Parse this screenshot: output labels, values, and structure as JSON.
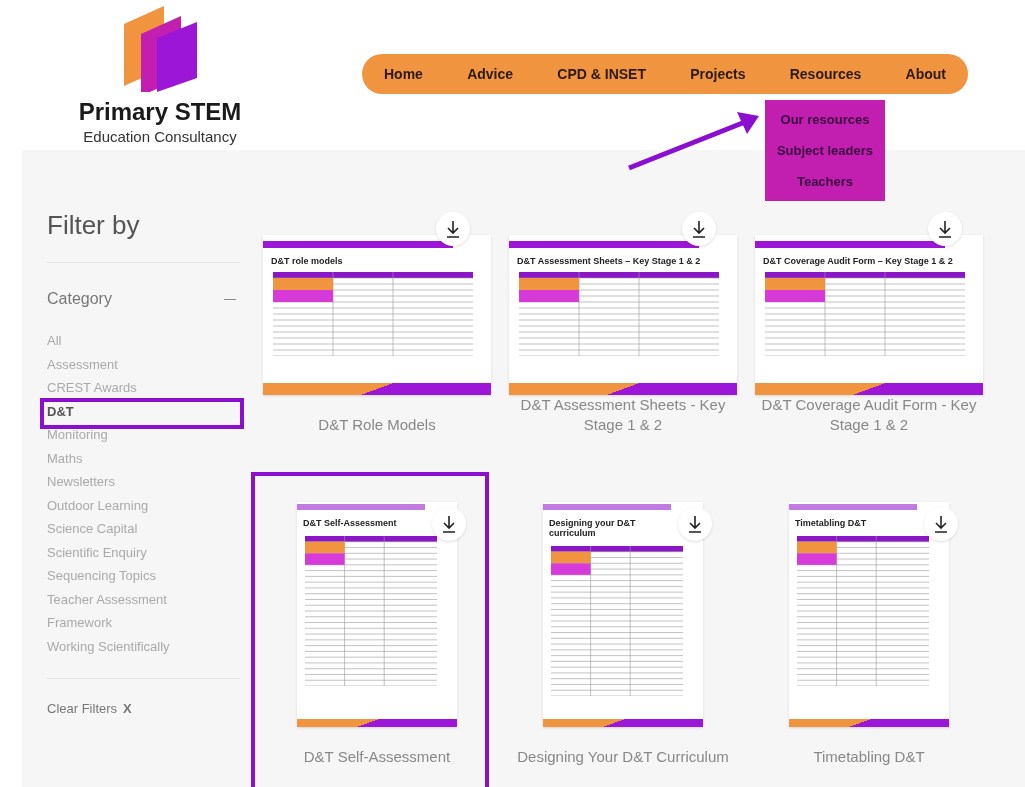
{
  "logo": {
    "title": "Primary STEM",
    "subtitle": "Education Consultancy"
  },
  "nav": [
    {
      "label": "Home"
    },
    {
      "label": "Advice"
    },
    {
      "label": "CPD & INSET"
    },
    {
      "label": "Projects"
    },
    {
      "label": "Resources",
      "expanded": true
    },
    {
      "label": "About"
    }
  ],
  "dropdown": [
    "Our resources",
    "Subject leaders",
    "Teachers"
  ],
  "filter": {
    "title": "Filter by",
    "group": "Category",
    "expanded": true,
    "categories": [
      {
        "label": "All",
        "selected": false,
        "annotated": false
      },
      {
        "label": "Assessment",
        "selected": false,
        "annotated": false
      },
      {
        "label": "CREST Awards",
        "selected": false,
        "annotated": false
      },
      {
        "label": "D&T",
        "selected": true,
        "annotated": true
      },
      {
        "label": "Monitoring",
        "selected": false,
        "annotated": false
      },
      {
        "label": "Maths",
        "selected": false,
        "annotated": false
      },
      {
        "label": "Newsletters",
        "selected": false,
        "annotated": false
      },
      {
        "label": "Outdoor Learning",
        "selected": false,
        "annotated": false
      },
      {
        "label": "Science Capital",
        "selected": false,
        "annotated": false
      },
      {
        "label": "Scientific Enquiry",
        "selected": false,
        "annotated": false
      },
      {
        "label": "Sequencing Topics",
        "selected": false,
        "annotated": false
      },
      {
        "label": "Teacher Assessment",
        "selected": false,
        "annotated": false
      },
      {
        "label": "Framework",
        "selected": false,
        "annotated": false
      },
      {
        "label": "Working Scientifically",
        "selected": false,
        "annotated": false
      }
    ],
    "clear": "Clear Filters",
    "clear_icon": "X"
  },
  "resources": [
    {
      "title": "D&T Role Models",
      "heading": "D&T role models",
      "kind": "landscape",
      "annotated": false
    },
    {
      "title": "D&T Assessment Sheets - Key Stage 1 & 2",
      "heading": "D&T Assessment Sheets – Key Stage 1 & 2",
      "kind": "landscape",
      "annotated": false
    },
    {
      "title": "D&T Coverage Audit Form - Key Stage 1 & 2",
      "heading": "D&T Coverage Audit Form – Key Stage 1 & 2",
      "kind": "landscape",
      "annotated": false
    },
    {
      "title": "D&T Self-Assessment",
      "heading": "D&T Self-Assessment",
      "kind": "portrait",
      "annotated": true
    },
    {
      "title": "Designing Your D&T Curriculum",
      "heading": "Designing your D&T curriculum",
      "kind": "portrait",
      "annotated": false
    },
    {
      "title": "Timetabling D&T",
      "heading": "Timetabling D&T",
      "kind": "portrait",
      "annotated": false
    }
  ],
  "annotations": [
    {
      "kind": "arrow"
    }
  ]
}
